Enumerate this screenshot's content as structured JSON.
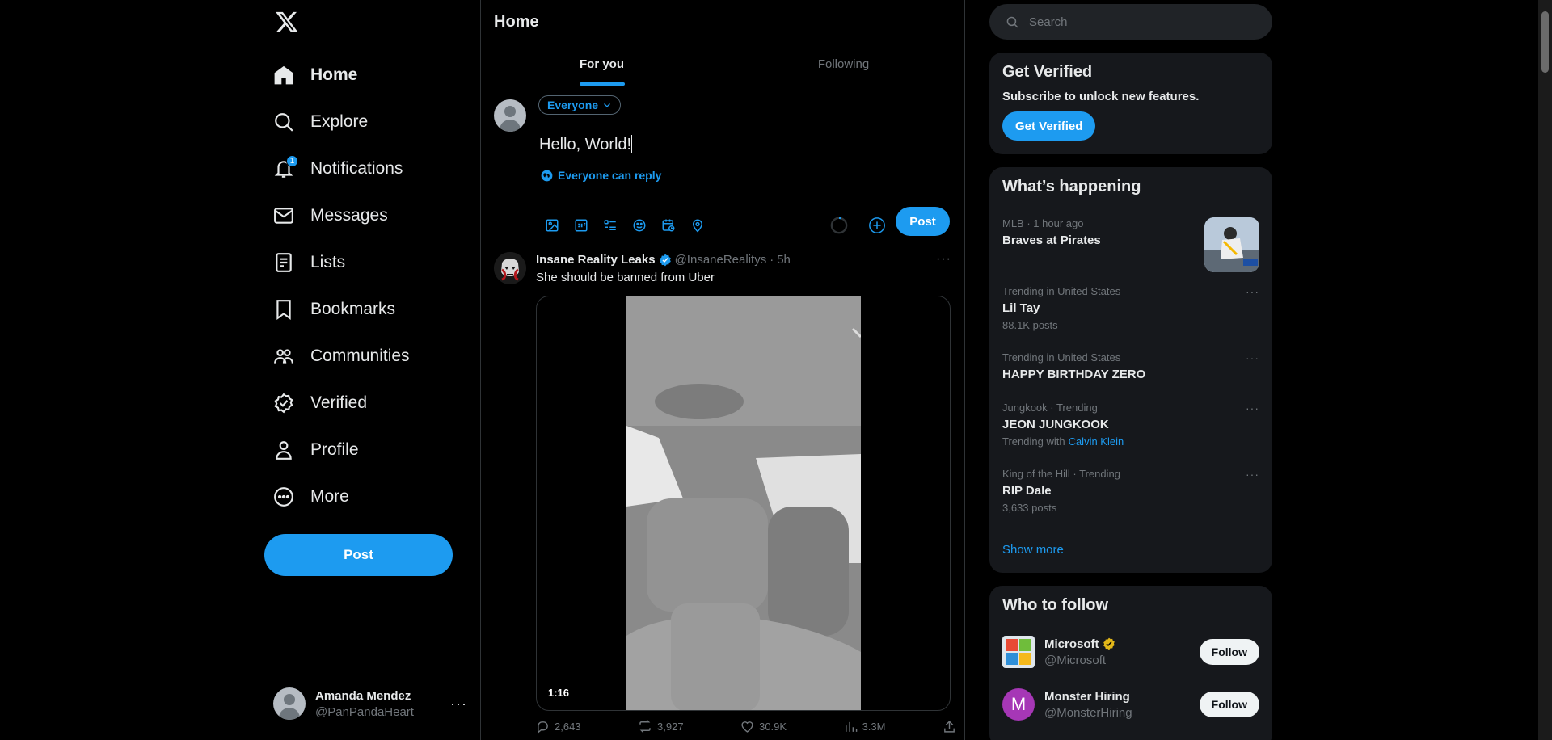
{
  "app": {
    "logo": "x-logo",
    "accent": "#1d9bf0"
  },
  "nav": {
    "items": [
      {
        "label": "Home",
        "icon": "home-icon",
        "active": true
      },
      {
        "label": "Explore",
        "icon": "search-icon"
      },
      {
        "label": "Notifications",
        "icon": "bell-icon",
        "badge": "1"
      },
      {
        "label": "Messages",
        "icon": "envelope-icon"
      },
      {
        "label": "Lists",
        "icon": "list-icon"
      },
      {
        "label": "Bookmarks",
        "icon": "bookmark-icon"
      },
      {
        "label": "Communities",
        "icon": "people-icon"
      },
      {
        "label": "Verified",
        "icon": "verified-icon"
      },
      {
        "label": "Profile",
        "icon": "person-icon"
      },
      {
        "label": "More",
        "icon": "more-circle-icon"
      }
    ],
    "post_label": "Post"
  },
  "account": {
    "name": "Amanda Mendez",
    "handle": "@PanPandaHeart",
    "more": "···"
  },
  "main": {
    "title": "Home",
    "tabs": [
      {
        "label": "For you",
        "active": true
      },
      {
        "label": "Following"
      }
    ]
  },
  "composer": {
    "audience": "Everyone",
    "text": "Hello, World!",
    "reply_setting": "Everyone can reply",
    "post_label": "Post",
    "tools": [
      "image-icon",
      "gif-icon",
      "poll-icon",
      "emoji-icon",
      "schedule-icon",
      "location-icon"
    ]
  },
  "tweet": {
    "name": "Insane Reality Leaks",
    "handle": "@InsaneRealitys",
    "dot": "·",
    "time": "5h",
    "text": "She should be banned from Uber",
    "video_duration": "1:16",
    "stats": {
      "replies": "2,643",
      "reposts": "3,927",
      "likes": "30.9K",
      "views": "3.3M"
    }
  },
  "right": {
    "search_placeholder": "Search",
    "verified": {
      "title": "Get Verified",
      "subtitle": "Subscribe to unlock new features.",
      "button": "Get Verified"
    },
    "happening": {
      "title": "What’s happening",
      "trends": [
        {
          "context": "MLB · 1 hour ago",
          "title": "Braves at Pirates",
          "count": ""
        },
        {
          "context": "Trending in United States",
          "title": "Lil Tay",
          "count": "88.1K posts"
        },
        {
          "context": "Trending in United States",
          "title": "HAPPY BIRTHDAY ZERO",
          "count": ""
        },
        {
          "context": "Jungkook · Trending",
          "title": "JEON JUNGKOOK",
          "with_label": "Trending with",
          "with_link": "Calvin Klein"
        },
        {
          "context": "King of the Hill · Trending",
          "title": "RIP Dale",
          "count": "3,633 posts"
        }
      ],
      "show_more": "Show more"
    },
    "who_to_follow": {
      "title": "Who to follow",
      "accounts": [
        {
          "name": "Microsoft",
          "handle": "@Microsoft",
          "badge_color": "#e2b719",
          "follow": "Follow"
        },
        {
          "name": "Monster Hiring",
          "handle": "@MonsterHiring",
          "letter": "M",
          "follow": "Follow"
        }
      ]
    }
  }
}
